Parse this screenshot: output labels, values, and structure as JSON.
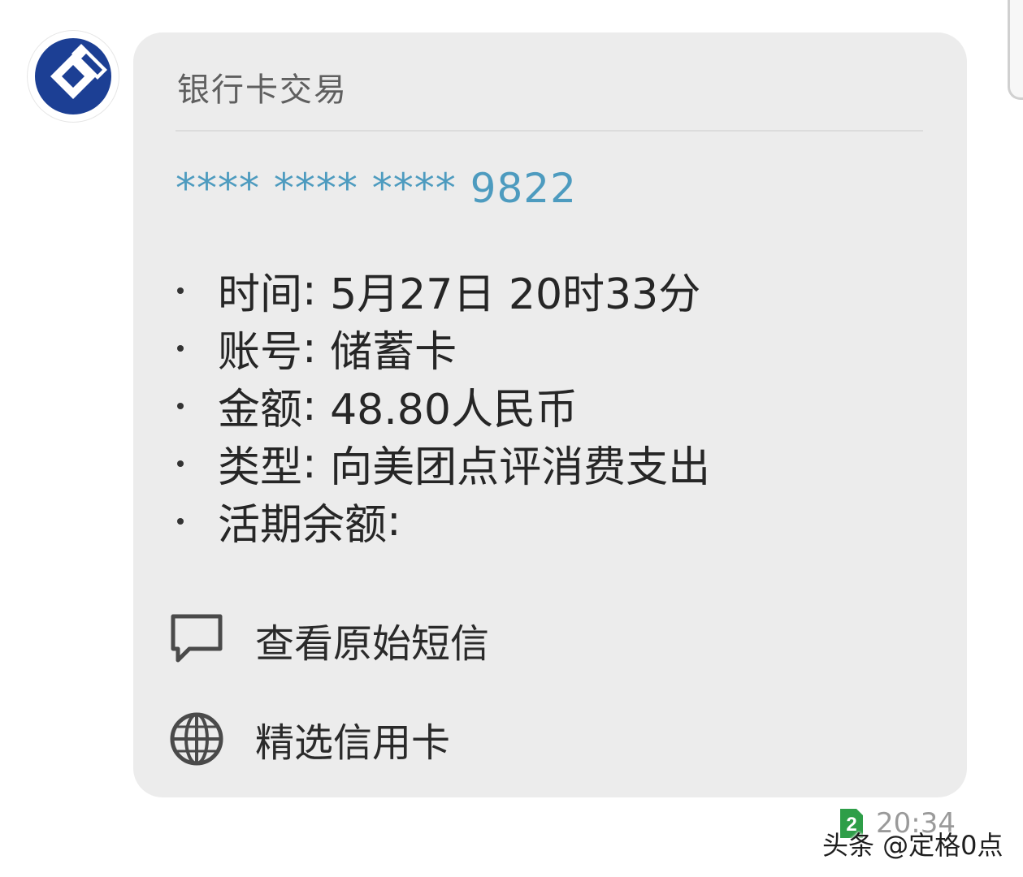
{
  "sender": {
    "avatar_icon": "bank-logo-icon",
    "brand_color": "#1c3f94"
  },
  "card": {
    "title": "银行卡交易",
    "card_number": "**** **** **** 9822",
    "number_color": "#4d9bbf",
    "details": [
      {
        "label": "时间",
        "separator": ": ",
        "value": "5月27日 20时33分"
      },
      {
        "label": "账号",
        "separator": ": ",
        "value": "储蓄卡"
      },
      {
        "label": "金额",
        "separator": ": ",
        "value": "48.80人民币"
      },
      {
        "label": "类型",
        "separator": ": ",
        "value": "向美团点评消费支出"
      },
      {
        "label": "活期余额",
        "separator": ":",
        "value": ""
      }
    ],
    "actions": [
      {
        "icon": "chat-bubble-icon",
        "label": "查看原始短信"
      },
      {
        "icon": "globe-icon",
        "label": "精选信用卡"
      }
    ]
  },
  "message_meta": {
    "sim_badge": "2",
    "sim_color": "#2e9e48",
    "time": "20:34"
  },
  "watermark": "头条 @定格0点"
}
